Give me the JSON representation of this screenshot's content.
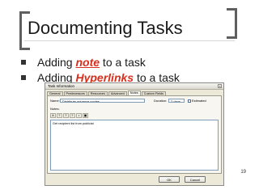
{
  "slide": {
    "title": "Documenting Tasks",
    "page_number": "19",
    "bullets": [
      {
        "prefix": "Adding ",
        "keyword": "note",
        "suffix": " to a task"
      },
      {
        "prefix": "Adding ",
        "keyword": "Hyperlinks",
        "suffix": " to a task"
      }
    ],
    "accent_color": "#d82e1c"
  },
  "dialog": {
    "title": "Task Information",
    "tabs": [
      "General",
      "Predecessors",
      "Resources",
      "Advanced",
      "Notes",
      "Custom Fields"
    ],
    "active_tab": "Notes",
    "name_label": "Name:",
    "name_value": "Distribute advance copies",
    "duration_label": "Duration:",
    "duration_value": "2 days",
    "estimated_label": "Estimated",
    "notes_label": "Notes:",
    "notes_text": "Get recipient list from publicist",
    "ok_label": "OK",
    "cancel_label": "Cancel"
  }
}
